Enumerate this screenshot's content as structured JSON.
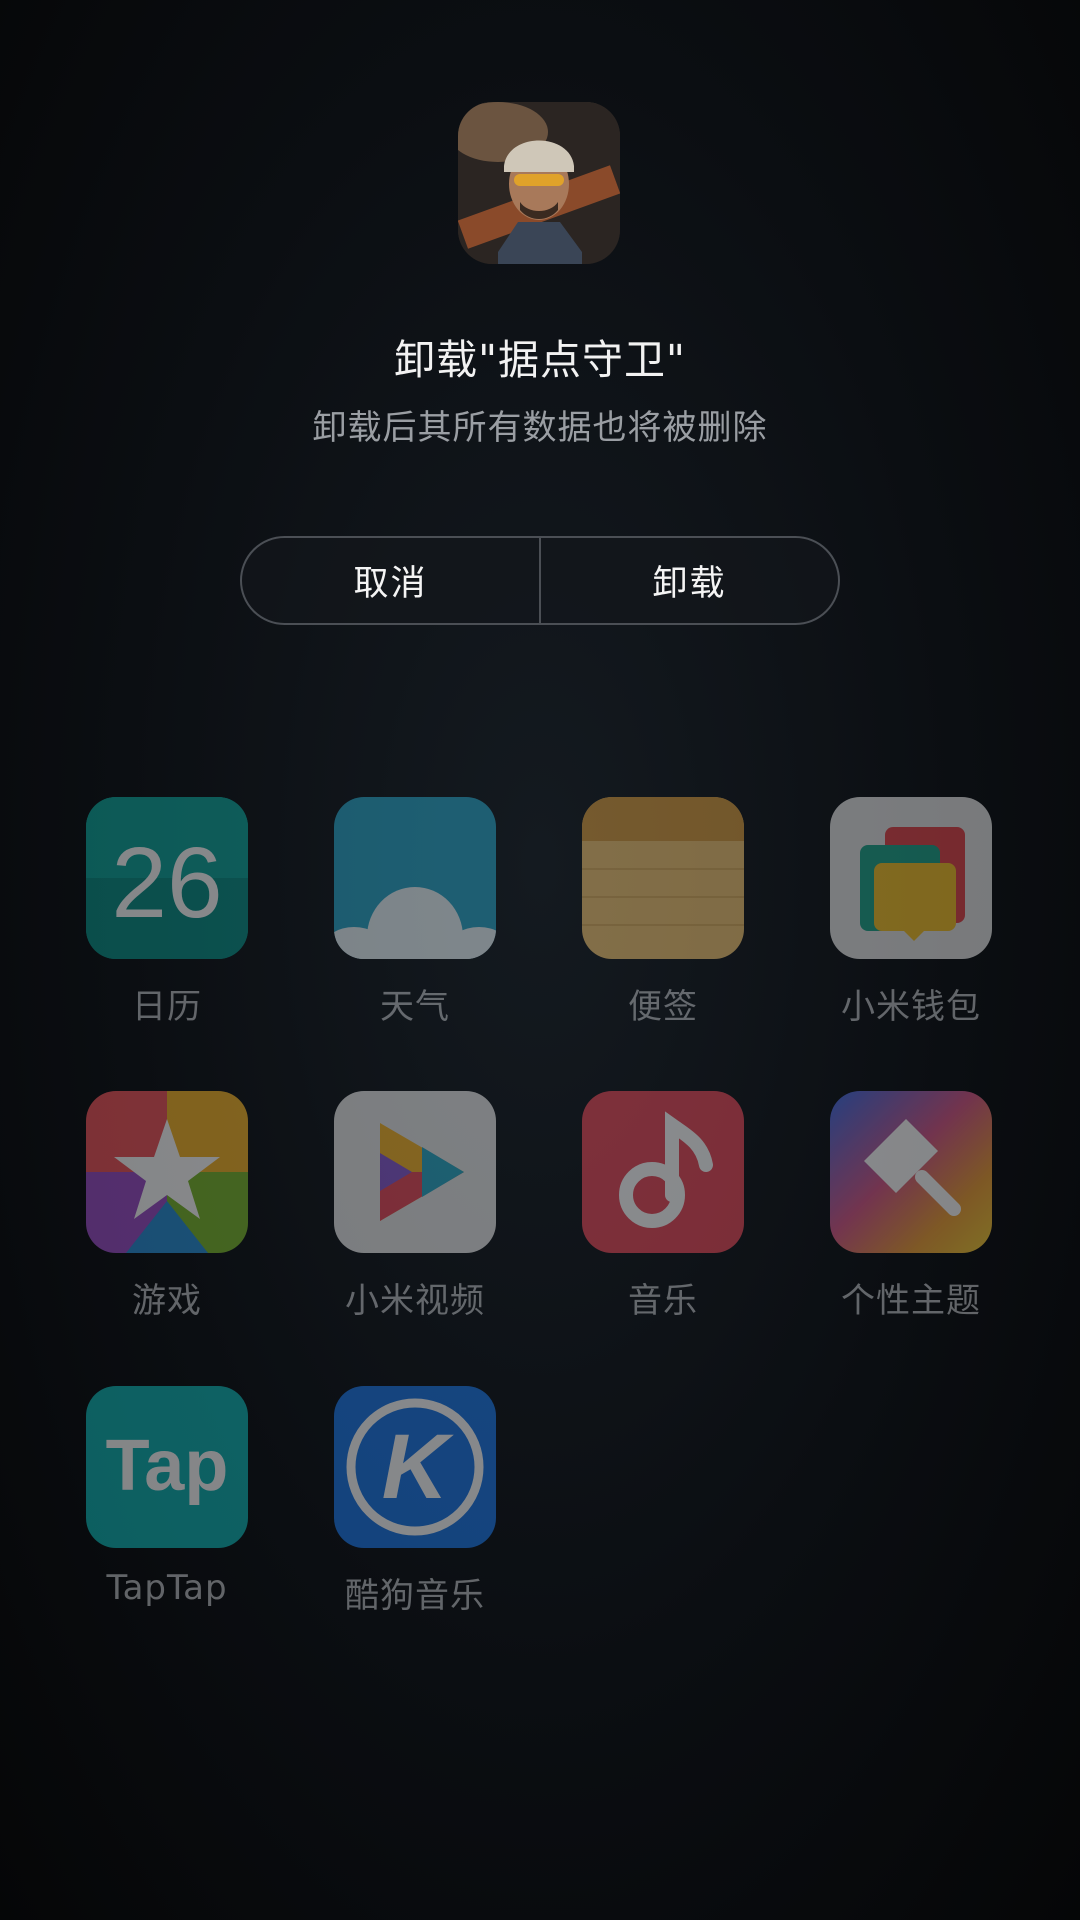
{
  "dialog": {
    "title": "卸载\"据点守卫\"",
    "subtitle": "卸载后其所有数据也将被删除",
    "cancel_label": "取消",
    "uninstall_label": "卸载",
    "app_icon": "soldier-avatar-icon"
  },
  "home_apps": [
    {
      "label": "日历",
      "icon": "calendar-icon",
      "icon_text": "26",
      "color": "#0e9e95"
    },
    {
      "label": "天气",
      "icon": "weather-icon",
      "color": "#2ea9c9"
    },
    {
      "label": "便签",
      "icon": "notes-icon",
      "color": "#e6b86a"
    },
    {
      "label": "小米钱包",
      "icon": "wallet-icon",
      "color": "#dcdcdc"
    },
    {
      "label": "游戏",
      "icon": "games-star-icon",
      "color": "#c0506a"
    },
    {
      "label": "小米视频",
      "icon": "video-play-icon",
      "color": "#e4e4e4"
    },
    {
      "label": "音乐",
      "icon": "music-note-icon",
      "color": "#e24a5a"
    },
    {
      "label": "个性主题",
      "icon": "theme-brush-icon",
      "color": "#5a7be0"
    },
    {
      "label": "TapTap",
      "icon": "taptap-icon",
      "icon_text": "Tap",
      "color": "#13b4b4"
    },
    {
      "label": "酷狗音乐",
      "icon": "kugou-icon",
      "icon_text": "K",
      "color": "#1e7ae8"
    }
  ]
}
